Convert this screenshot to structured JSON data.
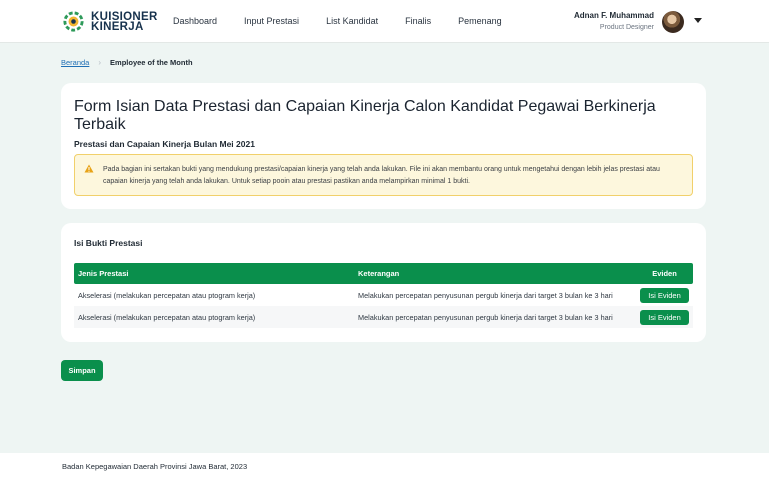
{
  "header": {
    "logo_line1": "KUISIONER",
    "logo_line2": "KINERJA",
    "nav": [
      "Dashboard",
      "Input Prestasi",
      "List Kandidat",
      "Finalis",
      "Pemenang"
    ],
    "user_name": "Adnan F. Muhammad",
    "user_role": "Product Designer"
  },
  "breadcrumb": {
    "home": "Beranda",
    "current": "Employee of the Month"
  },
  "form": {
    "title": "Form Isian Data Prestasi dan Capaian Kinerja Calon Kandidat Pegawai Berkinerja Terbaik",
    "section_title": "Prestasi dan Capaian Kinerja Bulan Mei 2021",
    "alert_text": "Pada bagian ini sertakan bukti yang mendukung prestasi/capaian kinerja yang telah anda lakukan. File ini akan membantu orang untuk mengetahui dengan lebih jelas prestasi atau capaian kinerja yang telah anda lakukan. Untuk setiap pooin atau prestasi pastikan anda melampirkan minimal 1 bukti."
  },
  "bukti": {
    "title": "Isi Bukti Prestasi",
    "columns": [
      "Jenis Prestasi",
      "Keterangan",
      "Eviden"
    ],
    "rows": [
      {
        "jenis": "Akselerasi (melakukan percepatan atau ptogram kerja)",
        "keterangan": "Melakukan percepatan penyusunan pergub kinerja dari target 3 bulan ke 3 hari",
        "button": "Isi Eviden"
      },
      {
        "jenis": "Akselerasi (melakukan percepatan atau ptogram kerja)",
        "keterangan": "Melakukan percepatan penyusunan pergub kinerja dari target 3 bulan ke 3 hari",
        "button": "Isi Eviden"
      }
    ]
  },
  "actions": {
    "save_label": "Simpan"
  },
  "footer": {
    "text": "Badan Kepegawaian Daerah Provinsi Jawa Barat, 2023"
  },
  "colors": {
    "primary": "#0a8f4c",
    "alert_bg": "#fdf7dd",
    "alert_border": "#f1d06b",
    "background": "#eef5f3"
  }
}
